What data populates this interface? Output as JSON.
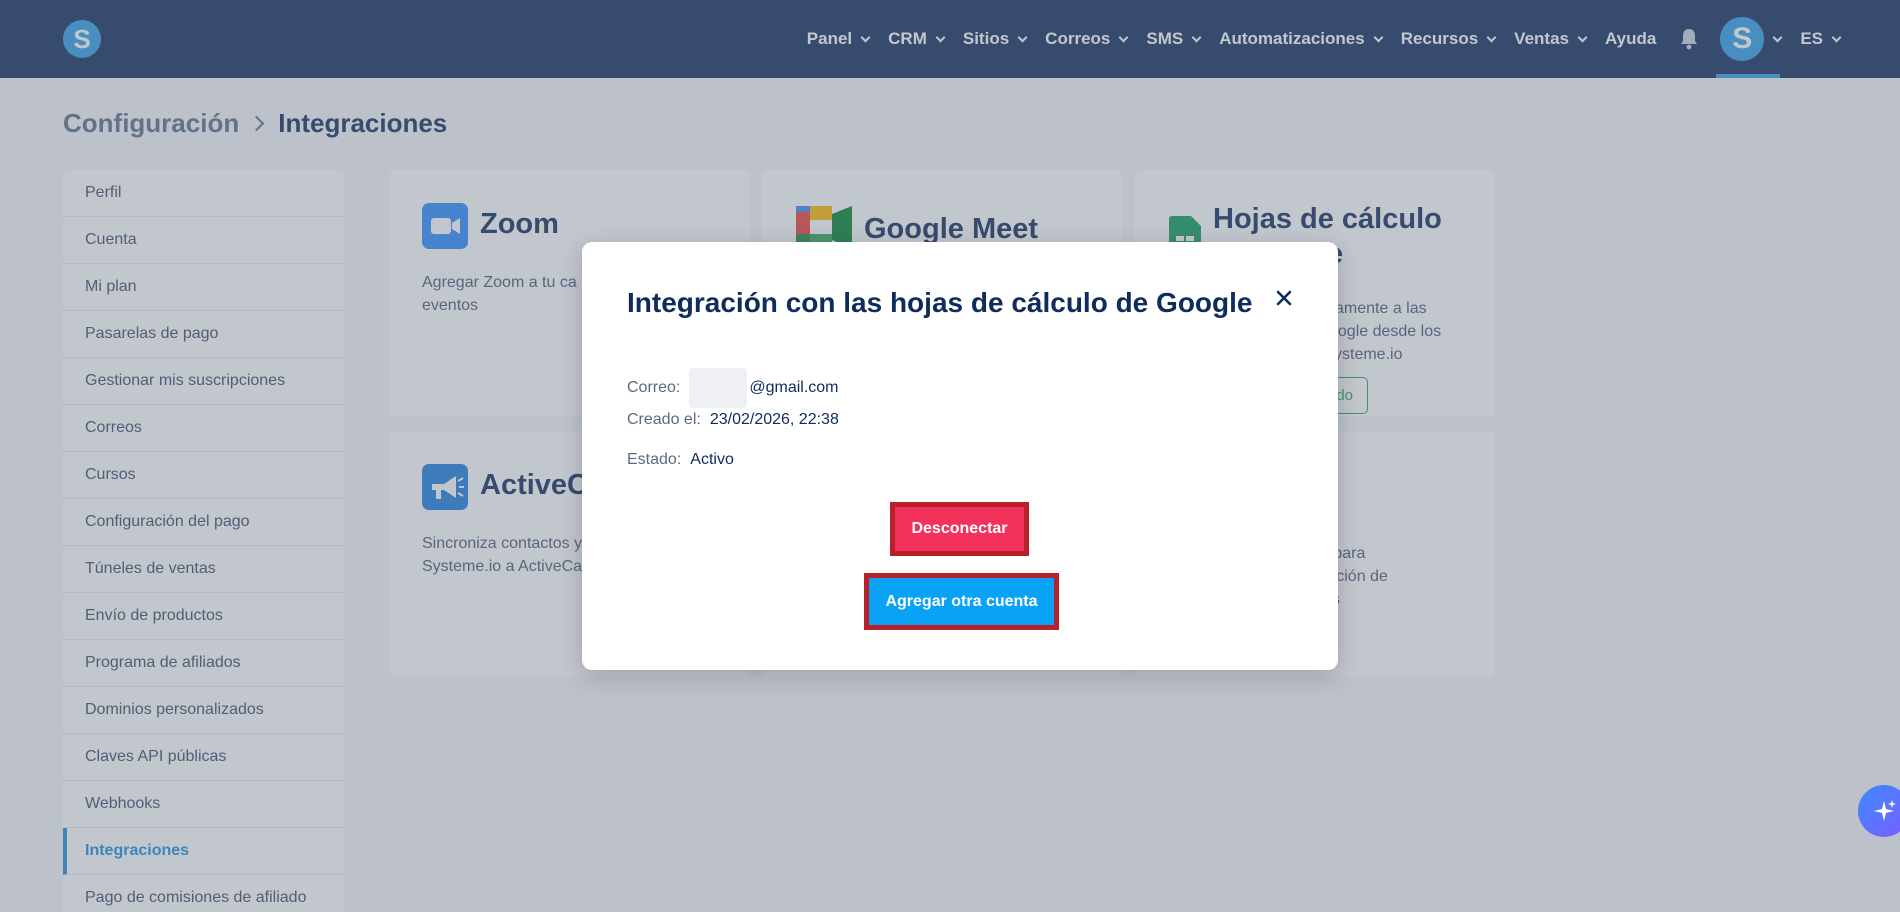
{
  "topbar": {
    "logo_letter": "S",
    "nav": [
      {
        "label": "Panel",
        "has_menu": true
      },
      {
        "label": "CRM",
        "has_menu": true
      },
      {
        "label": "Sitios",
        "has_menu": true
      },
      {
        "label": "Correos",
        "has_menu": true
      },
      {
        "label": "SMS",
        "has_menu": true
      },
      {
        "label": "Automatizaciones",
        "has_menu": true
      },
      {
        "label": "Recursos",
        "has_menu": true
      },
      {
        "label": "Ventas",
        "has_menu": true
      },
      {
        "label": "Ayuda",
        "has_menu": false
      }
    ],
    "avatar_letter": "S",
    "language": "ES",
    "bg_color": "#0f2c5c",
    "accent_color": "#2f9fea"
  },
  "breadcrumb": {
    "parent": "Configuración",
    "current": "Integraciones"
  },
  "sidebar": {
    "items": [
      {
        "label": "Perfil"
      },
      {
        "label": "Cuenta"
      },
      {
        "label": "Mi plan"
      },
      {
        "label": "Pasarelas de pago"
      },
      {
        "label": "Gestionar mis suscripciones"
      },
      {
        "label": "Correos"
      },
      {
        "label": "Cursos"
      },
      {
        "label": "Configuración del pago"
      },
      {
        "label": "Túneles de ventas"
      },
      {
        "label": "Envío de productos"
      },
      {
        "label": "Programa de afiliados"
      },
      {
        "label": "Dominios personalizados"
      },
      {
        "label": "Claves API públicas"
      },
      {
        "label": "Webhooks"
      },
      {
        "label": "Integraciones"
      },
      {
        "label": "Pago de comisiones de afiliado"
      }
    ],
    "active": "Integraciones"
  },
  "cards": {
    "zoom": {
      "title": "Zoom",
      "desc_line1": "Agregar Zoom a tu ca",
      "desc_line2": "eventos",
      "icon": "zoom-video-icon"
    },
    "meet": {
      "title": "Google Meet",
      "icon": "google-meet-icon"
    },
    "sheets": {
      "title_line1": "Hojas de cálculo",
      "title_line2": "e",
      "desc_line1": "amente a las",
      "desc_line2": "oogle desde los",
      "desc_line3": "ysteme.io",
      "connected_label": "do",
      "icon": "google-sheets-icon"
    },
    "activecampaign": {
      "title": "ActiveC",
      "desc_line1": "Sincroniza contactos y",
      "desc_line2": "Systeme.io a ActiveCa",
      "icon": "megaphone-icon"
    },
    "fourth": {
      "desc_line1": "o para",
      "desc_line2": "función de",
      "desc_line3": "s"
    }
  },
  "modal": {
    "title": "Integración con las hojas de cálculo de Google",
    "email_label": "Correo:",
    "email_value": "@gmail.com",
    "created_label": "Creado el:",
    "created_value": "23/02/2026, 22:38",
    "status_label": "Estado:",
    "status_value": "Activo",
    "disconnect_label": "Desconectar",
    "add_account_label": "Agregar otra cuenta",
    "disconnect_color": "#f2325a",
    "add_color": "#0aa2f5",
    "highlight_color": "#b8202a"
  }
}
